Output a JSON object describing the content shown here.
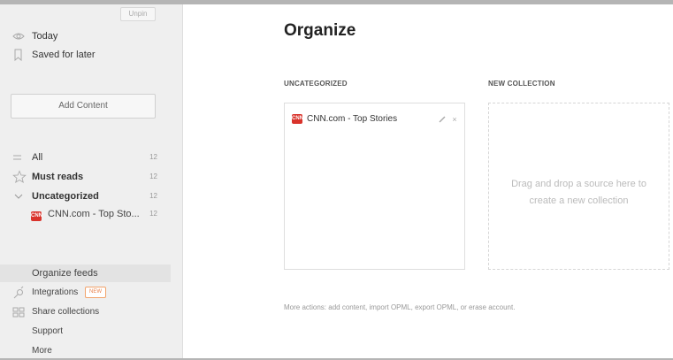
{
  "sidebar": {
    "unpin_label": "Unpin",
    "today_label": "Today",
    "saved_label": "Saved for later",
    "add_content_label": "Add Content",
    "feeds": {
      "all": {
        "label": "All",
        "count": "12"
      },
      "must_reads": {
        "label": "Must reads",
        "count": "12"
      },
      "uncategorized": {
        "label": "Uncategorized",
        "count": "12"
      },
      "cnn": {
        "label": "CNN.com - Top Sto...",
        "count": "12",
        "badge": "CNN"
      }
    },
    "organize_feeds_label": "Organize feeds",
    "integrations_label": "Integrations",
    "new_badge": "NEW",
    "share_collections_label": "Share collections",
    "support_label": "Support",
    "more_label": "More"
  },
  "main": {
    "title": "Organize",
    "uncategorized_header": "UNCATEGORIZED",
    "new_collection_header": "NEW COLLECTION",
    "source": {
      "label": "CNN.com - Top Stories",
      "badge": "CNN"
    },
    "remove_glyph": "×",
    "drop_text_1": "Drag and drop a source here to",
    "drop_text_2": "create a new collection",
    "more_actions": "More actions: add content, import OPML, export OPML, or erase account."
  },
  "colors": {
    "sidebar_bg": "#efefef",
    "selected_row_bg": "#e3e3e3",
    "cnn_red": "#d9332b",
    "new_badge_orange": "#e8804a"
  }
}
